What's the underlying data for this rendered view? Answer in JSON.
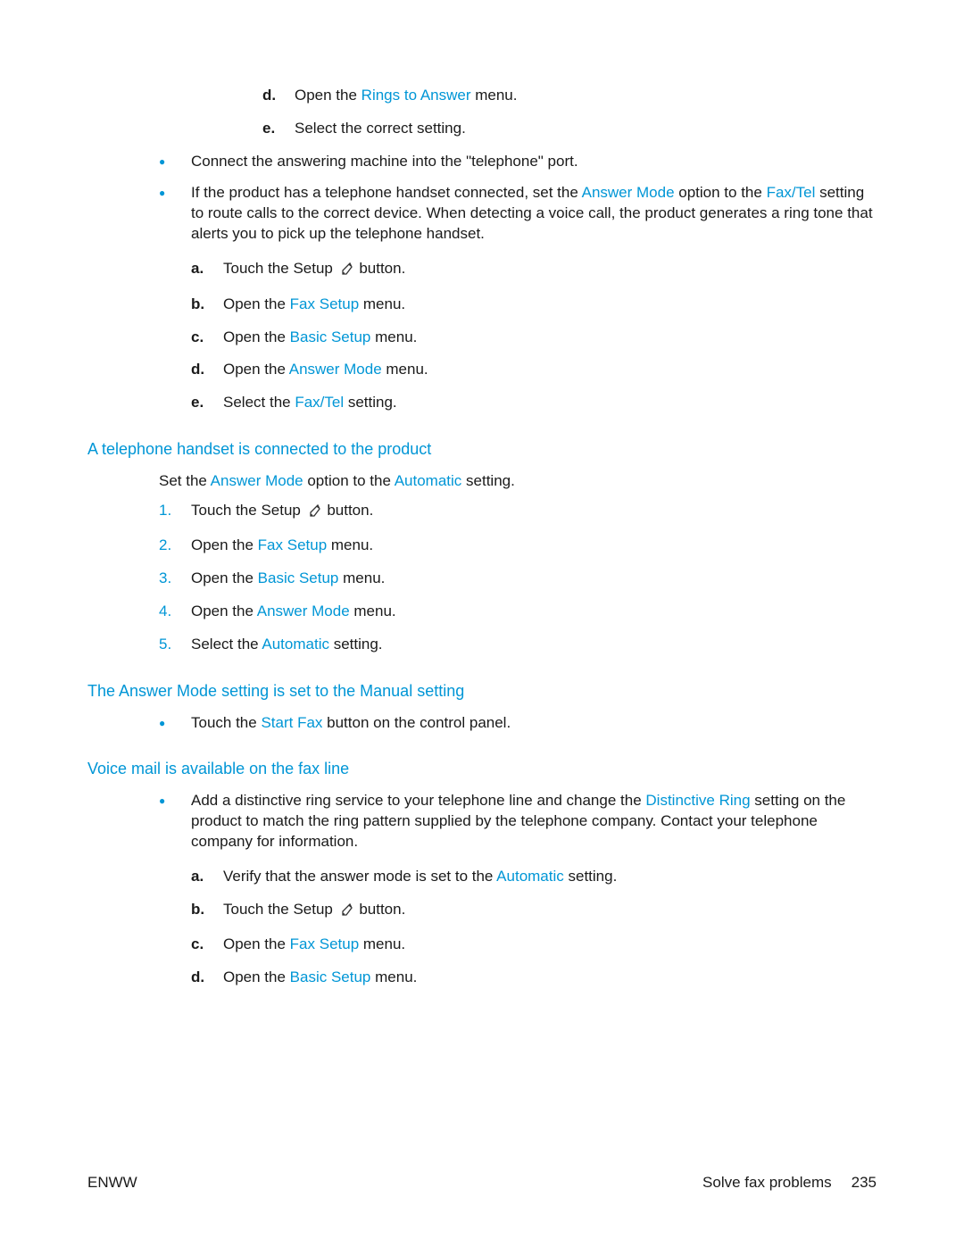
{
  "topSteps": {
    "d": {
      "pre": "Open the ",
      "link": "Rings to Answer",
      "post": " menu."
    },
    "e": "Select the correct setting."
  },
  "bullets1": {
    "first": "Connect the answering machine into the \"telephone\" port.",
    "second": {
      "pre": "If the product has a telephone handset connected, set the ",
      "link1": "Answer Mode",
      "mid": " option to the ",
      "link2": "Fax/Tel",
      "post": " setting to route calls to the correct device. When detecting a voice call, the product generates a ring tone that alerts you to pick up the telephone handset."
    },
    "sub": {
      "a": {
        "pre": "Touch the Setup ",
        "post": " button."
      },
      "b": {
        "pre": "Open the ",
        "link": "Fax Setup",
        "post": " menu."
      },
      "c": {
        "pre": "Open the ",
        "link": "Basic Setup",
        "post": " menu."
      },
      "d": {
        "pre": "Open the ",
        "link": "Answer Mode",
        "post": " menu."
      },
      "e": {
        "pre": "Select the ",
        "link": "Fax/Tel",
        "post": " setting."
      }
    }
  },
  "section2": {
    "heading": "A telephone handset is connected to the product",
    "intro": {
      "pre": "Set the ",
      "link1": "Answer Mode",
      "mid": " option to the ",
      "link2": "Automatic",
      "post": " setting."
    },
    "steps": {
      "1": {
        "pre": "Touch the Setup ",
        "post": " button."
      },
      "2": {
        "pre": "Open the ",
        "link": "Fax Setup",
        "post": " menu."
      },
      "3": {
        "pre": "Open the ",
        "link": "Basic Setup",
        "post": " menu."
      },
      "4": {
        "pre": "Open the ",
        "link": "Answer Mode",
        "post": " menu."
      },
      "5": {
        "pre": "Select the ",
        "link": "Automatic",
        "post": " setting."
      }
    }
  },
  "section3": {
    "heading": "The Answer Mode setting is set to the Manual setting",
    "bullet": {
      "pre": "Touch the ",
      "link": "Start Fax",
      "post": " button on the control panel."
    }
  },
  "section4": {
    "heading": "Voice mail is available on the fax line",
    "bullet": {
      "pre": "Add a distinctive ring service to your telephone line and change the ",
      "link": "Distinctive Ring",
      "post": " setting on the product to match the ring pattern supplied by the telephone company. Contact your telephone company for information."
    },
    "sub": {
      "a": {
        "pre": "Verify that the answer mode is set to the ",
        "link": "Automatic",
        "post": " setting."
      },
      "b": {
        "pre": "Touch the Setup ",
        "post": " button."
      },
      "c": {
        "pre": "Open the ",
        "link": "Fax Setup",
        "post": " menu."
      },
      "d": {
        "pre": "Open the ",
        "link": "Basic Setup",
        "post": " menu."
      }
    }
  },
  "footer": {
    "left": "ENWW",
    "section": "Solve fax problems",
    "page": "235"
  }
}
